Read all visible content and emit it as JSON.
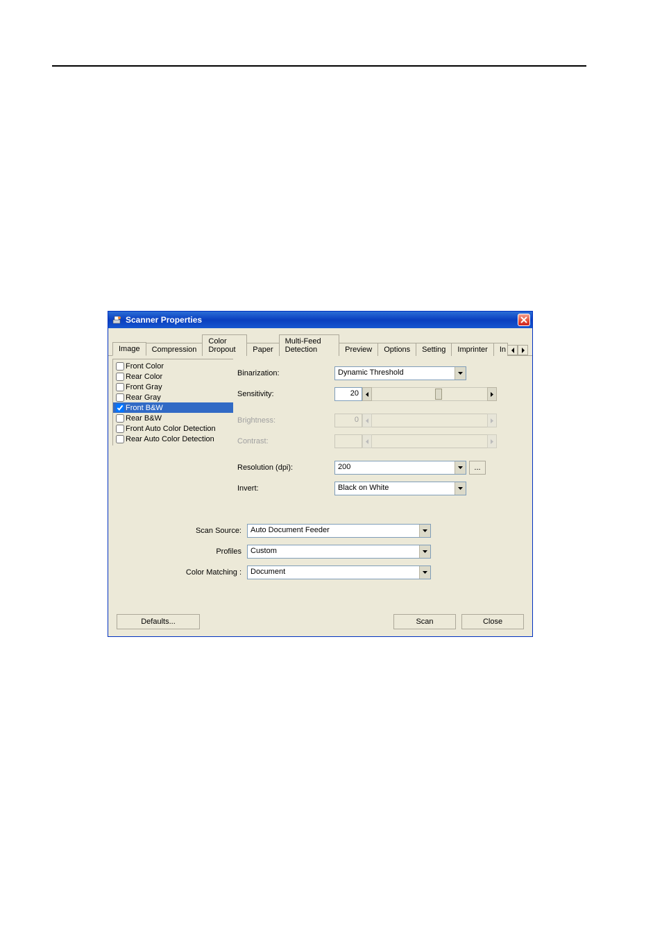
{
  "window": {
    "title": "Scanner Properties"
  },
  "tabs": {
    "t0": "Image",
    "t1": "Compression",
    "t2": "Color Dropout",
    "t3": "Paper",
    "t4": "Multi-Feed Detection",
    "t5": "Preview",
    "t6": "Options",
    "t7": "Setting",
    "t8": "Imprinter",
    "t9": "In"
  },
  "checklist": {
    "c0": "Front Color",
    "c1": "Rear Color",
    "c2": "Front Gray",
    "c3": "Rear Gray",
    "c4": "Front B&W",
    "c5": "Rear B&W",
    "c6": "Front Auto Color Detection",
    "c7": "Rear Auto Color Detection"
  },
  "labels": {
    "binarization": "Binarization:",
    "sensitivity": "Sensitivity:",
    "brightness": "Brightness:",
    "contrast": "Contrast:",
    "resolution": "Resolution (dpi):",
    "invert": "Invert:",
    "scan_source": "Scan Source:",
    "profiles": "Profiles",
    "color_matching": "Color Matching :"
  },
  "values": {
    "binarization": "Dynamic Threshold",
    "sensitivity": "20",
    "brightness": "0",
    "contrast": "",
    "resolution": "200",
    "invert": "Black on White",
    "scan_source": "Auto Document Feeder",
    "profiles": "Custom",
    "color_matching": "Document",
    "ellipsis": "..."
  },
  "buttons": {
    "defaults": "Defaults...",
    "scan": "Scan",
    "close": "Close"
  }
}
